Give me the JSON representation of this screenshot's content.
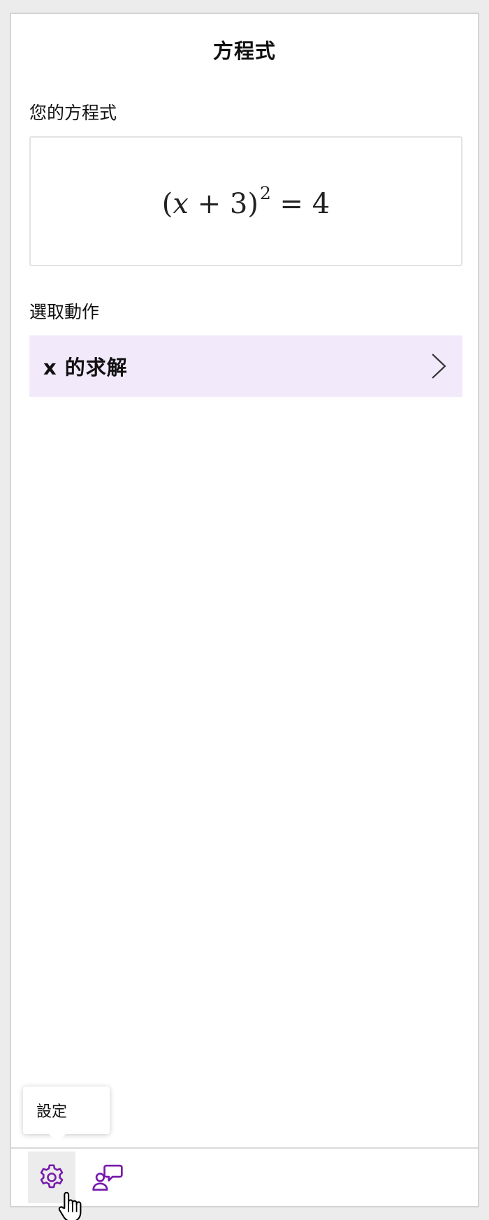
{
  "header": {
    "title": "方程式"
  },
  "equation_section": {
    "label": "您的方程式",
    "equation": {
      "lparen": "(",
      "var": "x",
      "op": " + 3",
      "rparen": ")",
      "exponent": "2",
      "rhs": " = 4"
    }
  },
  "action_section": {
    "label": "選取動作",
    "actions": [
      {
        "label": "x 的求解"
      }
    ]
  },
  "tooltip": {
    "text": "設定"
  },
  "bottom_bar": {
    "buttons": [
      {
        "icon": "gear-icon",
        "name": "settings"
      },
      {
        "icon": "feedback-icon",
        "name": "feedback"
      }
    ]
  },
  "colors": {
    "accent_purple": "#7719aa",
    "action_row_bg": "#f2eafb"
  }
}
